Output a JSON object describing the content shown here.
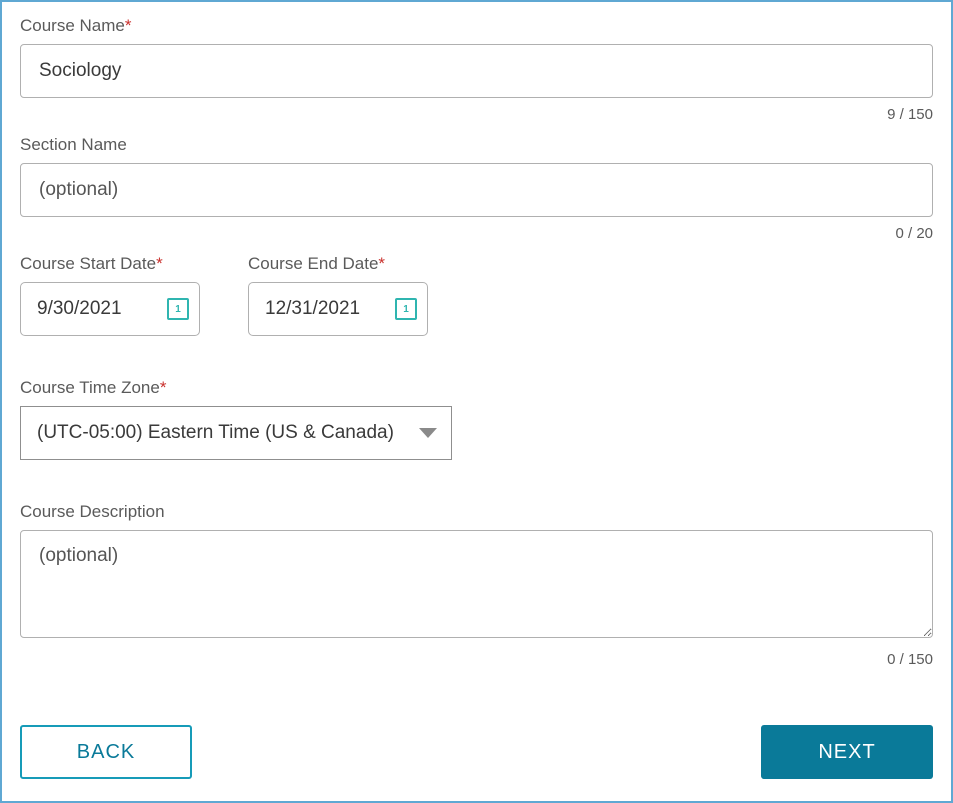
{
  "course_name": {
    "label": "Course Name",
    "required_marker": "*",
    "value": "Sociology",
    "counter": "9 / 150"
  },
  "section_name": {
    "label": "Section Name",
    "placeholder": "(optional)",
    "value": "",
    "counter": "0 / 20"
  },
  "start_date": {
    "label": "Course Start Date",
    "required_marker": "*",
    "value": "9/30/2021"
  },
  "end_date": {
    "label": "Course End Date",
    "required_marker": "*",
    "value": "12/31/2021"
  },
  "timezone": {
    "label": "Course Time Zone",
    "required_marker": "*",
    "selected": "(UTC-05:00) Eastern Time (US & Canada)"
  },
  "description": {
    "label": "Course Description",
    "placeholder": "(optional)",
    "value": "",
    "counter": "0 / 150"
  },
  "buttons": {
    "back": "BACK",
    "next": "NEXT"
  }
}
